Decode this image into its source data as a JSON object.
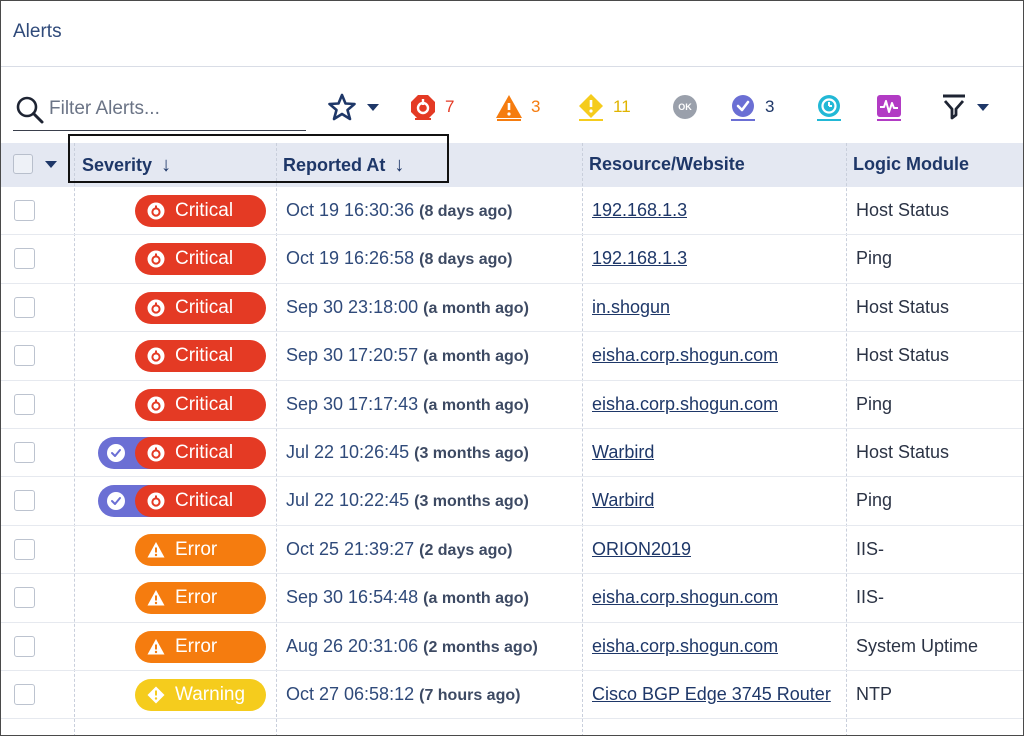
{
  "header": {
    "title": "Alerts"
  },
  "search": {
    "placeholder": "Filter Alerts..."
  },
  "toolbar": {
    "critical_count": "7",
    "error_count": "3",
    "warning_count": "11",
    "ok_label": "OK",
    "acked_count": "3",
    "colors": {
      "critical": "#e43a24",
      "error": "#f57c0f",
      "warning": "#f5cc1d",
      "acked": "#6b6fd4",
      "sdt": "#22b8d6",
      "chart": "#b23bc4",
      "nav": "#1e3768"
    }
  },
  "columns": {
    "severity": "Severity",
    "reported_at": "Reported At",
    "resource": "Resource/Website",
    "logic_module": "Logic Module"
  },
  "rows": [
    {
      "severity": "Critical",
      "level": "critical",
      "acked": false,
      "time": "Oct 19 16:30:36",
      "ago": "(8 days ago)",
      "resource": "192.168.1.3",
      "module": "Host Status"
    },
    {
      "severity": "Critical",
      "level": "critical",
      "acked": false,
      "time": "Oct 19 16:26:58",
      "ago": "(8 days ago)",
      "resource": "192.168.1.3",
      "module": "Ping"
    },
    {
      "severity": "Critical",
      "level": "critical",
      "acked": false,
      "time": "Sep 30 23:18:00",
      "ago": "(a month ago)",
      "resource": "in.shogun",
      "module": "Host Status"
    },
    {
      "severity": "Critical",
      "level": "critical",
      "acked": false,
      "time": "Sep 30 17:20:57",
      "ago": "(a month ago)",
      "resource": "eisha.corp.shogun.com",
      "module": "Host Status"
    },
    {
      "severity": "Critical",
      "level": "critical",
      "acked": false,
      "time": "Sep 30 17:17:43",
      "ago": "(a month ago)",
      "resource": "eisha.corp.shogun.com",
      "module": "Ping"
    },
    {
      "severity": "Critical",
      "level": "critical",
      "acked": true,
      "time": "Jul 22 10:26:45",
      "ago": "(3 months ago)",
      "resource": "Warbird",
      "module": "Host Status"
    },
    {
      "severity": "Critical",
      "level": "critical",
      "acked": true,
      "time": "Jul 22 10:22:45",
      "ago": "(3 months ago)",
      "resource": "Warbird",
      "module": "Ping"
    },
    {
      "severity": "Error",
      "level": "error",
      "acked": false,
      "time": "Oct 25 21:39:27",
      "ago": "(2 days ago)",
      "resource": "ORION2019",
      "module": "IIS-"
    },
    {
      "severity": "Error",
      "level": "error",
      "acked": false,
      "time": "Sep 30 16:54:48",
      "ago": "(a month ago)",
      "resource": "eisha.corp.shogun.com",
      "module": "IIS-"
    },
    {
      "severity": "Error",
      "level": "error",
      "acked": false,
      "time": "Aug 26 20:31:06",
      "ago": "(2 months ago)",
      "resource": "eisha.corp.shogun.com",
      "module": "System Uptime"
    },
    {
      "severity": "Warning",
      "level": "warning",
      "acked": false,
      "time": "Oct 27 06:58:12",
      "ago": "(7 hours ago)",
      "resource": "Cisco BGP Edge 3745 Router",
      "module": "NTP"
    }
  ]
}
